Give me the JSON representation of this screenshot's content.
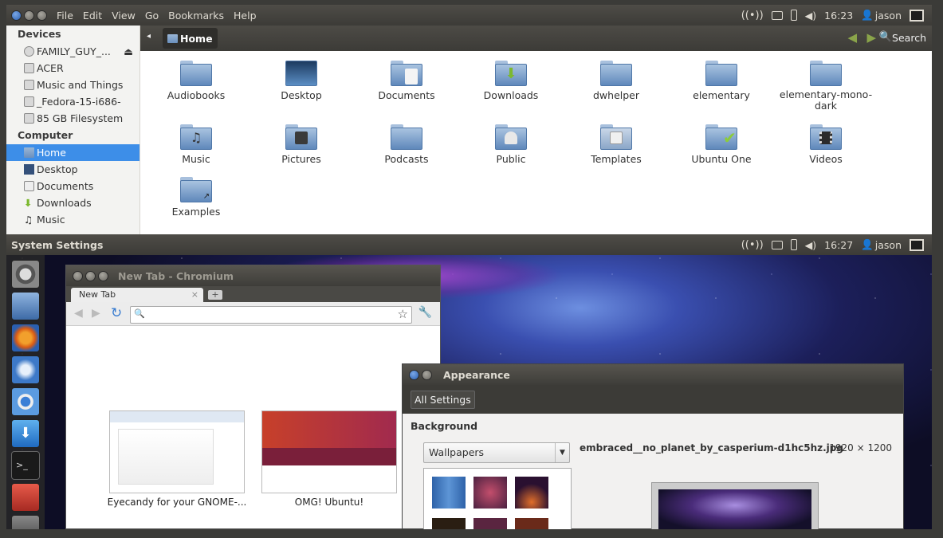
{
  "top_panel": {
    "menus": [
      "File",
      "Edit",
      "View",
      "Go",
      "Bookmarks",
      "Help"
    ],
    "time": "16:23",
    "user": "jason"
  },
  "sidebar": {
    "devices_header": "Devices",
    "devices": [
      "FAMILY_GUY_...",
      "ACER",
      "Music and Things",
      "_Fedora-15-i686-",
      "85 GB Filesystem"
    ],
    "computer_header": "Computer",
    "computer": [
      "Home",
      "Desktop",
      "Documents",
      "Downloads",
      "Music"
    ]
  },
  "toolbar": {
    "location": "Home",
    "search_label": "Search"
  },
  "files": [
    "Audiobooks",
    "Desktop",
    "Documents",
    "Downloads",
    "dwhelper",
    "elementary",
    "elementary-mono-dark",
    "Music",
    "Pictures",
    "Podcasts",
    "Public",
    "Templates",
    "Ubuntu One",
    "Videos",
    "Examples"
  ],
  "bottom_panel": {
    "title": "System Settings",
    "time": "16:27",
    "user": "jason"
  },
  "chromium": {
    "title": "New Tab - Chromium",
    "tab_label": "New Tab",
    "new_tab": "+",
    "close_tab": "×",
    "thumbnails": [
      "Eyecandy for your GNOME-...",
      "OMG! Ubuntu!"
    ]
  },
  "appearance": {
    "title": "Appearance",
    "all_settings": "All Settings",
    "background_label": "Background",
    "combo_value": "Wallpapers",
    "wallpaper_name": "embraced__no_planet_by_casperium-d1hc5hz.jpg",
    "wallpaper_size": "1920 × 1200"
  }
}
